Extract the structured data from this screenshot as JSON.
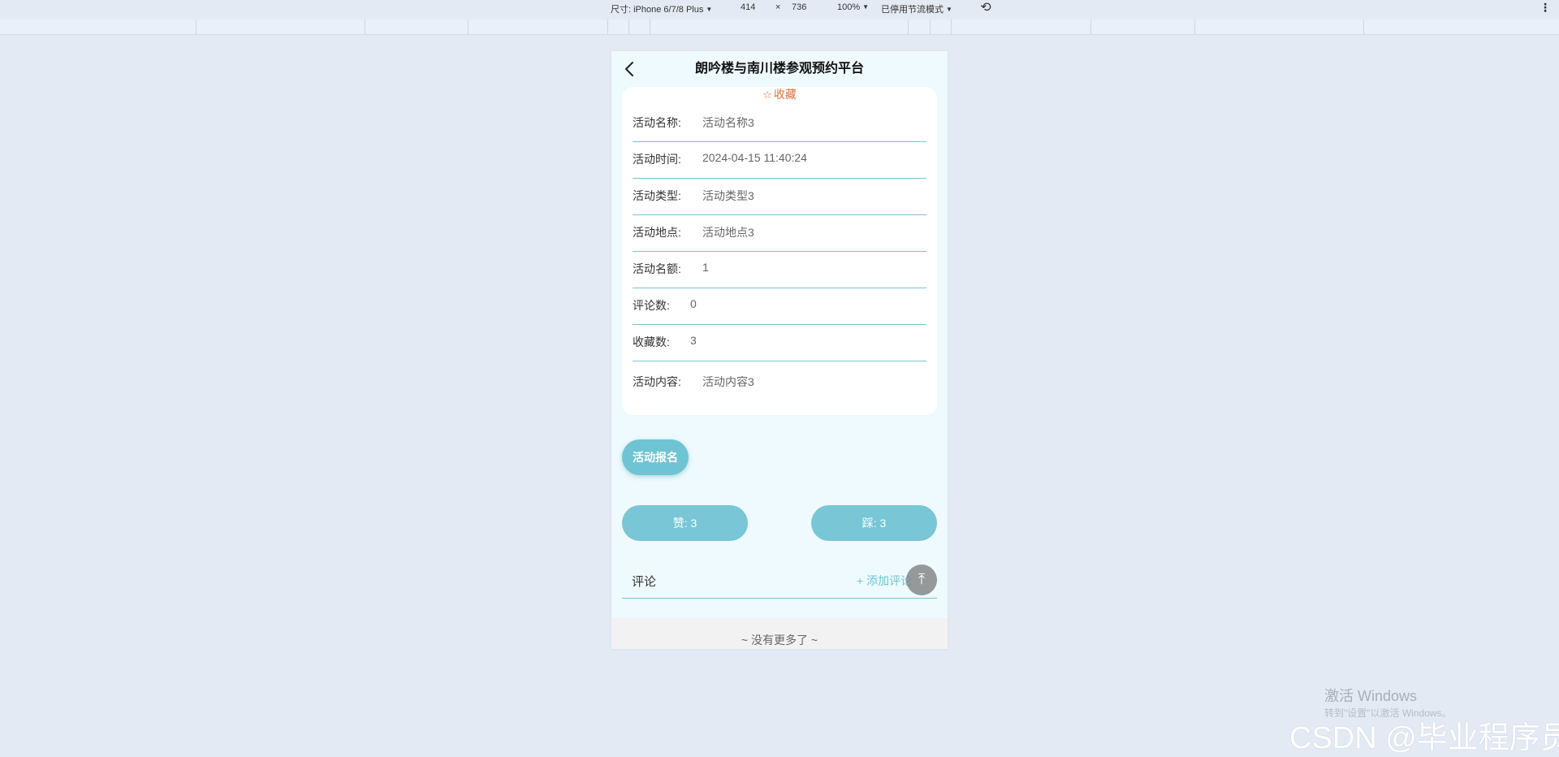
{
  "devtools": {
    "size_label": "尺寸: iPhone 6/7/8 Plus",
    "width": "414",
    "times": "×",
    "height": "736",
    "zoom": "100%",
    "throttle": "已停用节流模式"
  },
  "header": {
    "title": "朗吟楼与南川楼参观预约平台"
  },
  "detail": {
    "favorite_label": "收藏",
    "rows": [
      {
        "label": "活动名称:",
        "value": "活动名称3"
      },
      {
        "label": "活动时间:",
        "value": "2024-04-15 11:40:24"
      },
      {
        "label": "活动类型:",
        "value": "活动类型3"
      },
      {
        "label": "活动地点:",
        "value": "活动地点3"
      },
      {
        "label": "活动名额:",
        "value": "1"
      },
      {
        "label": "评论数:",
        "value": "0"
      },
      {
        "label": "收藏数:",
        "value": "3"
      },
      {
        "label": "活动内容:",
        "value": "活动内容3"
      }
    ]
  },
  "actions": {
    "signup": "活动报名",
    "like": "赞:  3",
    "dislike": "踩:  3"
  },
  "comments": {
    "label": "评论",
    "add": "+ 添加评论"
  },
  "footer": {
    "no_more": "~ 没有更多了 ~"
  },
  "watermark": {
    "activate_title": "激活 Windows",
    "activate_sub": "转到\"设置\"以激活 Windows。",
    "csdn": "CSDN @毕业程序员"
  }
}
